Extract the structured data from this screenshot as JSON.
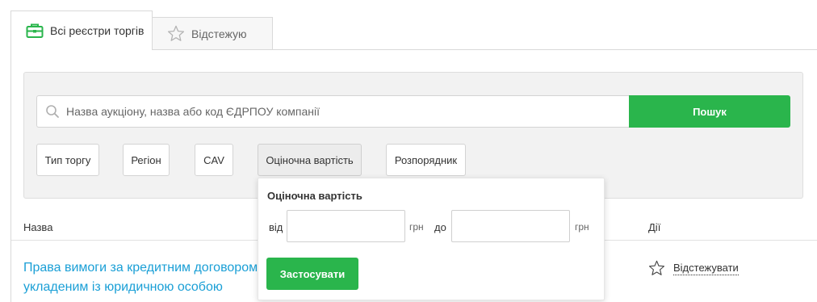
{
  "tabs": {
    "all_registries": {
      "label": "Всі реєстри торгів",
      "icon": "briefcase-icon"
    },
    "watching": {
      "label": "Відстежую",
      "icon": "star-icon"
    }
  },
  "search": {
    "placeholder": "Назва аукціону, назва або код ЄДРПОУ компанії",
    "value": "",
    "button_label": "Пошук"
  },
  "filters": [
    {
      "label": "Тип торгу"
    },
    {
      "label": "Регіон"
    },
    {
      "label": "CAV"
    },
    {
      "label": "Оціночна вартість"
    },
    {
      "label": "Розпорядник"
    }
  ],
  "table": {
    "columns": {
      "name": "Назва",
      "actions": "Дії"
    },
    "rows": [
      {
        "title": "Права вимоги за кредитним договором укладеним із юридичною особою",
        "action_label": "Відстежувати"
      }
    ]
  },
  "value_popover": {
    "title": "Оціночна вартість",
    "from_label": "від",
    "to_label": "до",
    "from_value": "",
    "to_value": "",
    "currency": "грн",
    "apply_label": "Застосувати"
  },
  "colors": {
    "accent_green": "#2ab54c",
    "link_blue": "#1a9fd6"
  }
}
